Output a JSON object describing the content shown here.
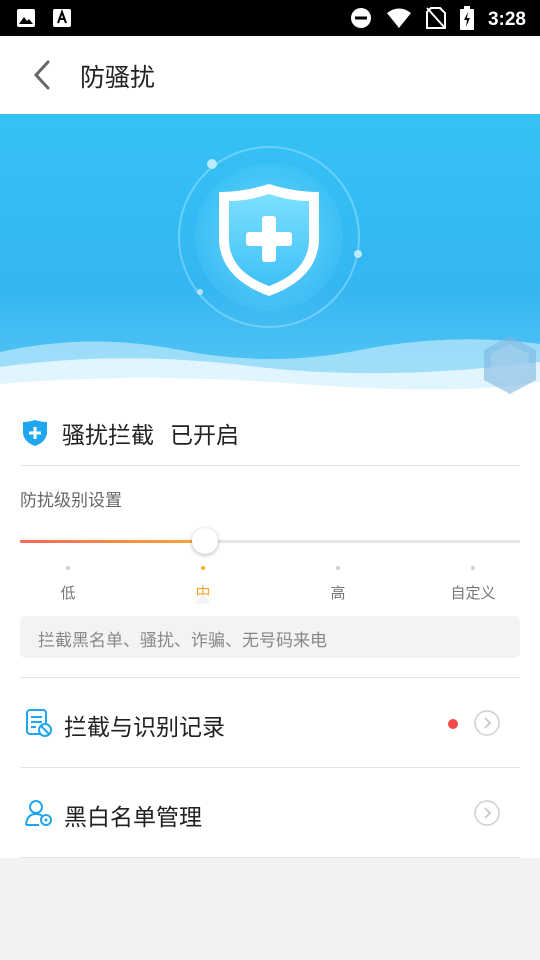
{
  "status_bar": {
    "time": "3:28",
    "left_icons": [
      "image-icon",
      "font-a-icon"
    ],
    "right_icons": [
      "do-not-disturb-icon",
      "wifi-icon",
      "no-sim-icon",
      "battery-charging-icon"
    ]
  },
  "header": {
    "title": "防骚扰",
    "back_icon": "chevron-left-icon"
  },
  "hero": {
    "icon": "shield-plus-icon"
  },
  "status": {
    "label": "骚扰拦截",
    "state": "已开启"
  },
  "level": {
    "title": "防扰级别设置",
    "levels": [
      "低",
      "中",
      "高",
      "自定义"
    ],
    "selected_index": 1,
    "slider_fraction": 0.37,
    "description": "拦截黑名单、骚扰、诈骗、无号码来电"
  },
  "menu": {
    "records_label": "拦截与识别记录",
    "records_has_badge": true,
    "blacklist_label": "黑白名单管理"
  },
  "colors": {
    "accent": "#34b6f2",
    "active_level": "#f5a623",
    "badge": "#f04a4a"
  }
}
